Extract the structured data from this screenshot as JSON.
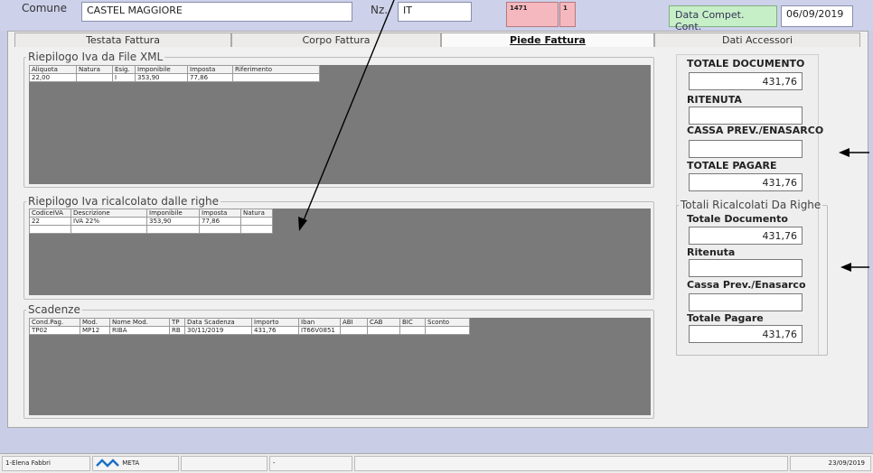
{
  "header": {
    "comune_label": "Comune",
    "comune_value": "CASTEL MAGGIORE",
    "nz_label": "Nz.",
    "nz_value": "IT",
    "pink_1": "1471",
    "pink_2": "1",
    "data_compet_label": "Data Compet. Cont.",
    "data_compet_value": "06/09/2019"
  },
  "tabs": [
    "Testata Fattura",
    "Corpo Fattura",
    "Piede Fattura",
    "Dati Accessori"
  ],
  "active_tab": "Piede Fattura",
  "riepilogo_xml": {
    "legend": "Riepilogo Iva da File XML",
    "columns": [
      "Aliquota",
      "Natura",
      "Esig.",
      "Imponibile",
      "Imposta",
      "Riferimento"
    ],
    "rows": [
      [
        "22,00",
        "",
        "I",
        "353,90",
        "77,86",
        ""
      ]
    ]
  },
  "riepilogo_righe": {
    "legend": "Riepilogo Iva ricalcolato dalle righe",
    "columns": [
      "CodiceIVA",
      "Descrizione",
      "Imponibile",
      "Imposta",
      "Natura"
    ],
    "rows": [
      [
        "22",
        "IVA 22%",
        "353,90",
        "77,86",
        ""
      ]
    ]
  },
  "scadenze": {
    "legend": "Scadenze",
    "columns": [
      "Cond.Pag.",
      "Mod.",
      "Nome Mod.",
      "TP",
      "Data Scadenza",
      "Importo",
      "Iban",
      "ABI",
      "CAB",
      "BIC",
      "Sconto"
    ],
    "rows": [
      [
        "TP02",
        "MP12",
        "RIBA",
        "RB",
        "30/11/2019",
        "431,76",
        "IT66V0851",
        "",
        "",
        "",
        ""
      ]
    ]
  },
  "totali": {
    "totale_documento_label": "TOTALE DOCUMENTO",
    "totale_documento_value": "431,76",
    "ritenuta_label": "RITENUTA",
    "ritenuta_value": "",
    "cassa_label": "CASSA PREV./ENASARCO",
    "cassa_value": "",
    "totale_pagare_label": "TOTALE PAGARE",
    "totale_pagare_value": "431,76"
  },
  "ricalcolati": {
    "legend": "Totali Ricalcolati Da Righe",
    "totale_documento_label": "Totale Documento",
    "totale_documento_value": "431,76",
    "ritenuta_label": "Ritenuta",
    "ritenuta_value": "",
    "cassa_label": "Cassa Prev./Enasarco",
    "cassa_value": "",
    "totale_pagare_label": "Totale Pagare",
    "totale_pagare_value": "431,76"
  },
  "statusbar": {
    "user": "1-Elena Fabbri",
    "app": "META",
    "middle": "-",
    "date": "23/09/2019"
  }
}
